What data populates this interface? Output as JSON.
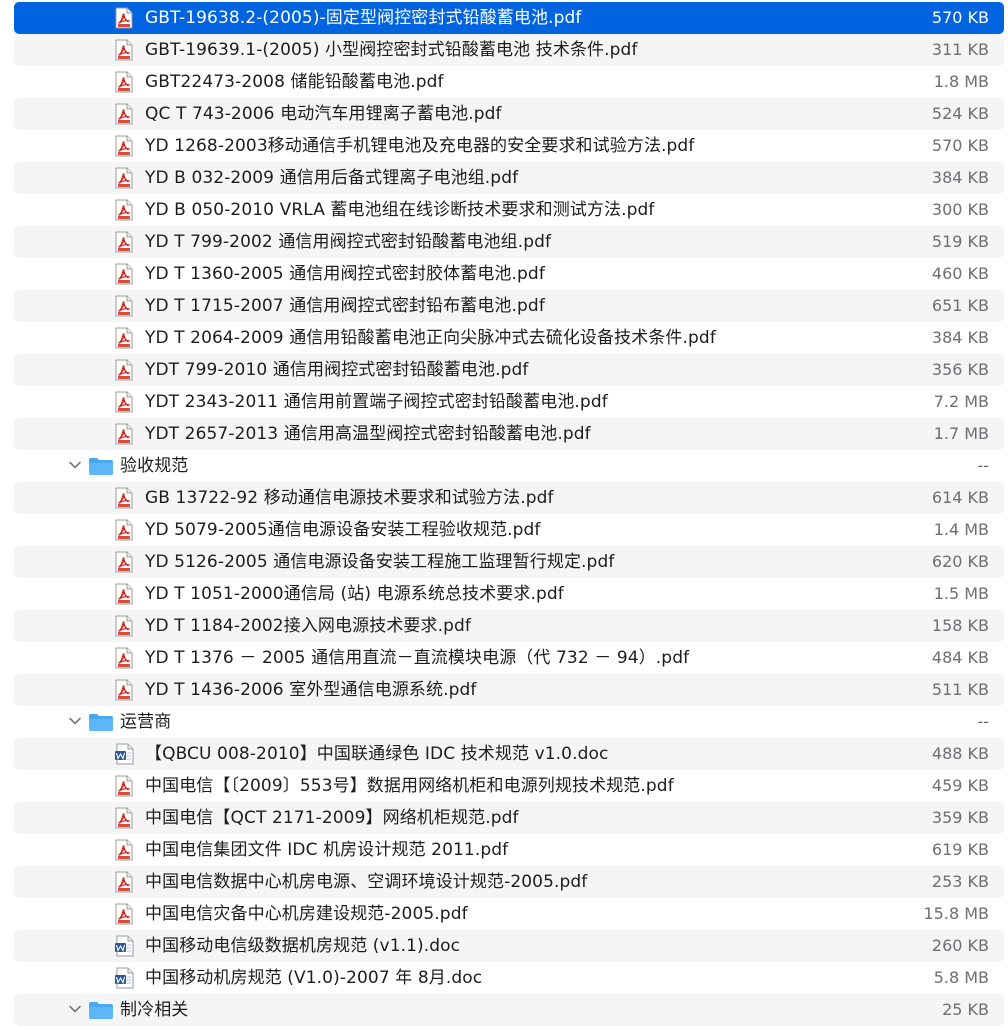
{
  "colors": {
    "selection": "#0064e1",
    "stripe": "#f4f5f5",
    "pdf_icon": "#d42b1e",
    "doc_icon": "#2b5797",
    "folder": "#4aa8f0"
  },
  "rows": [
    {
      "kind": "pdf",
      "name": "GBT-19638.2-(2005)-固定型阀控密封式铅酸蓄电池.pdf",
      "size": "570 KB",
      "selected": true
    },
    {
      "kind": "pdf",
      "name": "GBT-19639.1-(2005) 小型阀控密封式铅酸蓄电池 技术条件.pdf",
      "size": "311 KB"
    },
    {
      "kind": "pdf",
      "name": "GBT22473-2008 储能铅酸蓄电池.pdf",
      "size": "1.8 MB"
    },
    {
      "kind": "pdf",
      "name": "QC T 743-2006 电动汽车用锂离子蓄电池.pdf",
      "size": "524 KB"
    },
    {
      "kind": "pdf",
      "name": "YD 1268-2003移动通信手机锂电池及充电器的安全要求和试验方法.pdf",
      "size": "570 KB"
    },
    {
      "kind": "pdf",
      "name": "YD B 032-2009 通信用后备式锂离子电池组.pdf",
      "size": "384 KB"
    },
    {
      "kind": "pdf",
      "name": "YD B 050-2010 VRLA 蓄电池组在线诊断技术要求和测试方法.pdf",
      "size": "300 KB"
    },
    {
      "kind": "pdf",
      "name": "YD T 799-2002 通信用阀控式密封铅酸蓄电池组.pdf",
      "size": "519 KB"
    },
    {
      "kind": "pdf",
      "name": "YD T 1360-2005 通信用阀控式密封胶体蓄电池.pdf",
      "size": "460 KB"
    },
    {
      "kind": "pdf",
      "name": "YD T 1715-2007 通信用阀控式密封铅布蓄电池.pdf",
      "size": "651 KB"
    },
    {
      "kind": "pdf",
      "name": "YD T 2064-2009 通信用铅酸蓄电池正向尖脉冲式去硫化设备技术条件.pdf",
      "size": "384 KB"
    },
    {
      "kind": "pdf",
      "name": "YDT 799-2010 通信用阀控式密封铅酸蓄电池.pdf",
      "size": "356 KB"
    },
    {
      "kind": "pdf",
      "name": "YDT 2343-2011 通信用前置端子阀控式密封铅酸蓄电池.pdf",
      "size": "7.2 MB"
    },
    {
      "kind": "pdf",
      "name": "YDT 2657-2013 通信用高温型阀控式密封铅酸蓄电池.pdf",
      "size": "1.7 MB"
    },
    {
      "kind": "folder",
      "name": "验收规范",
      "size": "--"
    },
    {
      "kind": "pdf",
      "name": "GB 13722-92 移动通信电源技术要求和试验方法.pdf",
      "size": "614 KB"
    },
    {
      "kind": "pdf",
      "name": "YD 5079-2005通信电源设备安装工程验收规范.pdf",
      "size": "1.4 MB"
    },
    {
      "kind": "pdf",
      "name": "YD 5126-2005 通信电源设备安装工程施工监理暂行规定.pdf",
      "size": "620 KB"
    },
    {
      "kind": "pdf",
      "name": "YD T 1051-2000通信局 (站) 电源系统总技术要求.pdf",
      "size": "1.5 MB"
    },
    {
      "kind": "pdf",
      "name": "YD T 1184-2002接入网电源技术要求.pdf",
      "size": "158 KB"
    },
    {
      "kind": "pdf",
      "name": "YD T 1376 － 2005 通信用直流－直流模块电源（代 732 － 94）.pdf",
      "size": "484 KB"
    },
    {
      "kind": "pdf",
      "name": "YD T 1436-2006 室外型通信电源系统.pdf",
      "size": "511 KB"
    },
    {
      "kind": "folder",
      "name": "运营商",
      "size": "--"
    },
    {
      "kind": "doc",
      "name": "【QBCU 008-2010】中国联通绿色 IDC 技术规范 v1.0.doc",
      "size": "488 KB"
    },
    {
      "kind": "pdf",
      "name": "中国电信【〔2009〕553号】数据用网络机柜和电源列规技术规范.pdf",
      "size": "459 KB"
    },
    {
      "kind": "pdf",
      "name": "中国电信【QCT 2171-2009】网络机柜规范.pdf",
      "size": "359 KB"
    },
    {
      "kind": "pdf",
      "name": "中国电信集团文件 IDC 机房设计规范 2011.pdf",
      "size": "619 KB"
    },
    {
      "kind": "pdf",
      "name": "中国电信数据中心机房电源、空调环境设计规范-2005.pdf",
      "size": "253 KB"
    },
    {
      "kind": "pdf",
      "name": "中国电信灾备中心机房建设规范-2005.pdf",
      "size": "15.8 MB"
    },
    {
      "kind": "doc",
      "name": "中国移动电信级数据机房规范 (v1.1).doc",
      "size": "260 KB"
    },
    {
      "kind": "doc",
      "name": "中国移动机房规范 (V1.0)-2007 年 8月.doc",
      "size": "5.8 MB"
    },
    {
      "kind": "folder",
      "name": "制冷相关",
      "size": "25 KB"
    }
  ]
}
